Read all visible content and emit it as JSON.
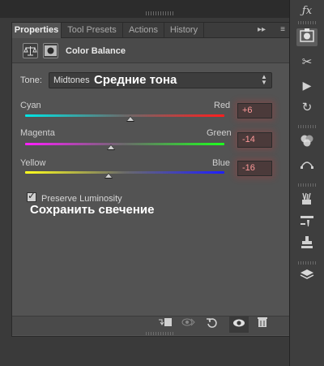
{
  "tabs": [
    "Properties",
    "Tool Presets",
    "Actions",
    "History"
  ],
  "tab_menu": {
    "collapse": "▸▸",
    "menu": "≡"
  },
  "header": {
    "title": "Color Balance"
  },
  "tone": {
    "label": "Tone:",
    "value": "Midtones",
    "annotation": "Средние тона"
  },
  "sliders": [
    {
      "left": "Cyan",
      "right": "Red",
      "value": "+6",
      "level": 6,
      "left_color": "#00ffff",
      "right_color": "#ff0000"
    },
    {
      "left": "Magenta",
      "right": "Green",
      "value": "-14",
      "level": -14,
      "left_color": "#ff00ff",
      "right_color": "#00ff00"
    },
    {
      "left": "Yellow",
      "right": "Blue",
      "value": "-16",
      "level": -16,
      "left_color": "#ffff00",
      "right_color": "#0000ff"
    }
  ],
  "preserve": {
    "label": "Preserve Luminosity",
    "checked": true,
    "annotation": "Сохранить свечение"
  },
  "footer_icons": [
    "clip-to-layer-icon",
    "view-previous-icon",
    "reset-icon",
    "visibility-eye-icon",
    "trash-icon"
  ],
  "right_toolbar_icons": [
    "fx-icon",
    "adjustments-icon",
    "tools-icon",
    "play-icon",
    "history-brush-icon",
    "channels-icon",
    "paths-icon",
    "brushes-icon",
    "brush-presets-icon",
    "clone-source-icon",
    "layers-icon"
  ],
  "colors": {
    "panel": "#535353",
    "value_text": "#ff9a9a"
  }
}
